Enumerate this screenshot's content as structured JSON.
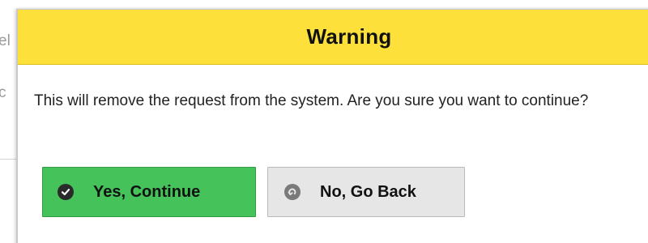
{
  "background": {
    "fragment_1": "el",
    "fragment_2": "c"
  },
  "dialog": {
    "title": "Warning",
    "message": "This will remove the request from the system. Are you sure you want to continue?",
    "header_color": "#fde13a",
    "buttons": {
      "confirm": {
        "label": "Yes, Continue",
        "icon": "check-circle-icon",
        "color": "#45c25a"
      },
      "cancel": {
        "label": "No, Go Back",
        "icon": "back-arrow-circle-icon",
        "color": "#e6e6e6"
      }
    }
  }
}
